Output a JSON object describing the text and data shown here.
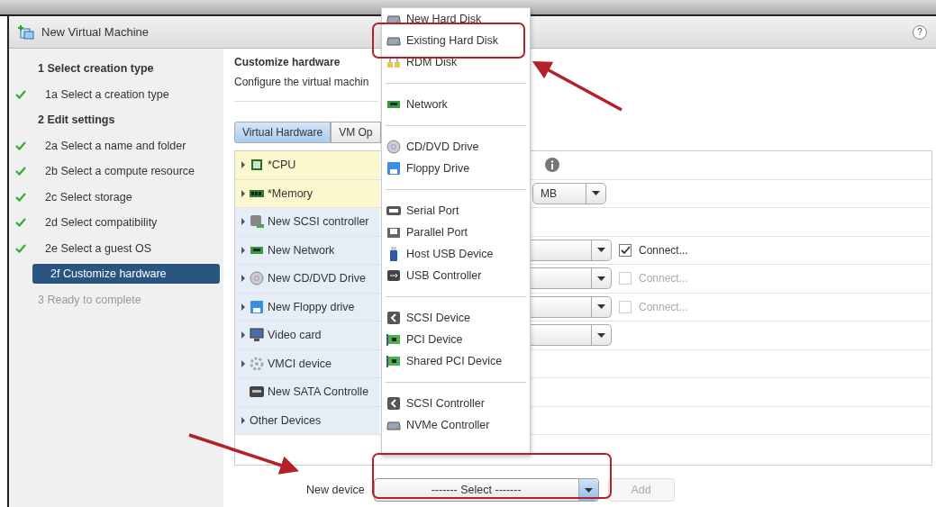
{
  "window": {
    "title": "New Virtual Machine",
    "help": "?"
  },
  "steps": [
    {
      "label": "1  Select creation type",
      "kind": "section",
      "done": false,
      "selected": false,
      "disabled": false
    },
    {
      "label": "1a  Select a creation type",
      "kind": "step",
      "done": true,
      "selected": false,
      "disabled": false
    },
    {
      "label": "2  Edit settings",
      "kind": "section",
      "done": false,
      "selected": false,
      "disabled": false
    },
    {
      "label": "2a  Select a name and folder",
      "kind": "step",
      "done": true,
      "selected": false,
      "disabled": false
    },
    {
      "label": "2b  Select a compute resource",
      "kind": "step",
      "done": true,
      "selected": false,
      "disabled": false
    },
    {
      "label": "2c  Select storage",
      "kind": "step",
      "done": true,
      "selected": false,
      "disabled": false
    },
    {
      "label": "2d  Select compatibility",
      "kind": "step",
      "done": true,
      "selected": false,
      "disabled": false
    },
    {
      "label": "2e  Select a guest OS",
      "kind": "step",
      "done": true,
      "selected": false,
      "disabled": false
    },
    {
      "label": "2f Customize hardware",
      "kind": "step",
      "done": false,
      "selected": true,
      "disabled": false
    },
    {
      "label": "3  Ready to complete",
      "kind": "section",
      "done": false,
      "selected": false,
      "disabled": true
    }
  ],
  "content": {
    "title": "Customize hardware",
    "subtitle": "Configure the virtual machin"
  },
  "tabs": [
    {
      "label": "Virtual Hardware",
      "selected": true
    },
    {
      "label": "VM Op",
      "selected": false
    }
  ],
  "hardware": [
    {
      "name": "*CPU",
      "kind": "cpu",
      "highlighted": true,
      "expandable": true,
      "select": false,
      "info": true
    },
    {
      "name": "*Memory",
      "kind": "memory",
      "highlighted": true,
      "expandable": true,
      "select": false,
      "info": false,
      "unit": "MB"
    },
    {
      "name": "New SCSI controller",
      "kind": "scsi-controller",
      "highlighted": false,
      "expandable": true,
      "select": false,
      "info": false
    },
    {
      "name": "New Network",
      "kind": "network",
      "highlighted": false,
      "expandable": true,
      "select": true,
      "info": false,
      "connect": {
        "label": "Connect...",
        "checked": true,
        "disabled": false
      }
    },
    {
      "name": "New CD/DVD Drive",
      "kind": "cdrom",
      "highlighted": false,
      "expandable": true,
      "select": true,
      "info": false,
      "connect": {
        "label": "Connect...",
        "checked": false,
        "disabled": true
      }
    },
    {
      "name": "New Floppy drive",
      "kind": "floppy",
      "highlighted": false,
      "expandable": true,
      "select": true,
      "info": false,
      "connect": {
        "label": "Connect...",
        "checked": false,
        "disabled": true
      }
    },
    {
      "name": "Video card",
      "kind": "video",
      "highlighted": false,
      "expandable": true,
      "select": true,
      "info": false
    },
    {
      "name": "VMCI device",
      "kind": "vmci",
      "highlighted": false,
      "expandable": true,
      "select": false,
      "info": false
    },
    {
      "name": "New SATA Controlle",
      "kind": "sata",
      "highlighted": false,
      "expandable": false,
      "select": false,
      "info": false
    },
    {
      "name": "Other Devices",
      "kind": "none",
      "highlighted": false,
      "expandable": true,
      "select": false,
      "info": false
    }
  ],
  "new_device": {
    "label": "New device",
    "value": "------- Select -------",
    "add": {
      "label": "Add",
      "disabled": true
    }
  },
  "menu": [
    [
      {
        "label": "New Hard Disk",
        "kind": "disk"
      },
      {
        "label": "Existing Hard Disk",
        "kind": "disk"
      },
      {
        "label": "RDM Disk",
        "kind": "rdm"
      }
    ],
    [
      {
        "label": "Network",
        "kind": "network"
      }
    ],
    [
      {
        "label": "CD/DVD Drive",
        "kind": "cdrom"
      },
      {
        "label": "Floppy Drive",
        "kind": "floppy"
      }
    ],
    [
      {
        "label": "Serial Port",
        "kind": "serial"
      },
      {
        "label": "Parallel Port",
        "kind": "parallel"
      },
      {
        "label": "Host USB Device",
        "kind": "usb"
      },
      {
        "label": "USB Controller",
        "kind": "usb-controller"
      }
    ],
    [
      {
        "label": "SCSI Device",
        "kind": "scsi"
      },
      {
        "label": "PCI Device",
        "kind": "pci"
      },
      {
        "label": "Shared PCI Device",
        "kind": "pci"
      }
    ],
    [
      {
        "label": "SCSI Controller",
        "kind": "scsi"
      },
      {
        "label": "NVMe Controller",
        "kind": "disk"
      }
    ]
  ]
}
